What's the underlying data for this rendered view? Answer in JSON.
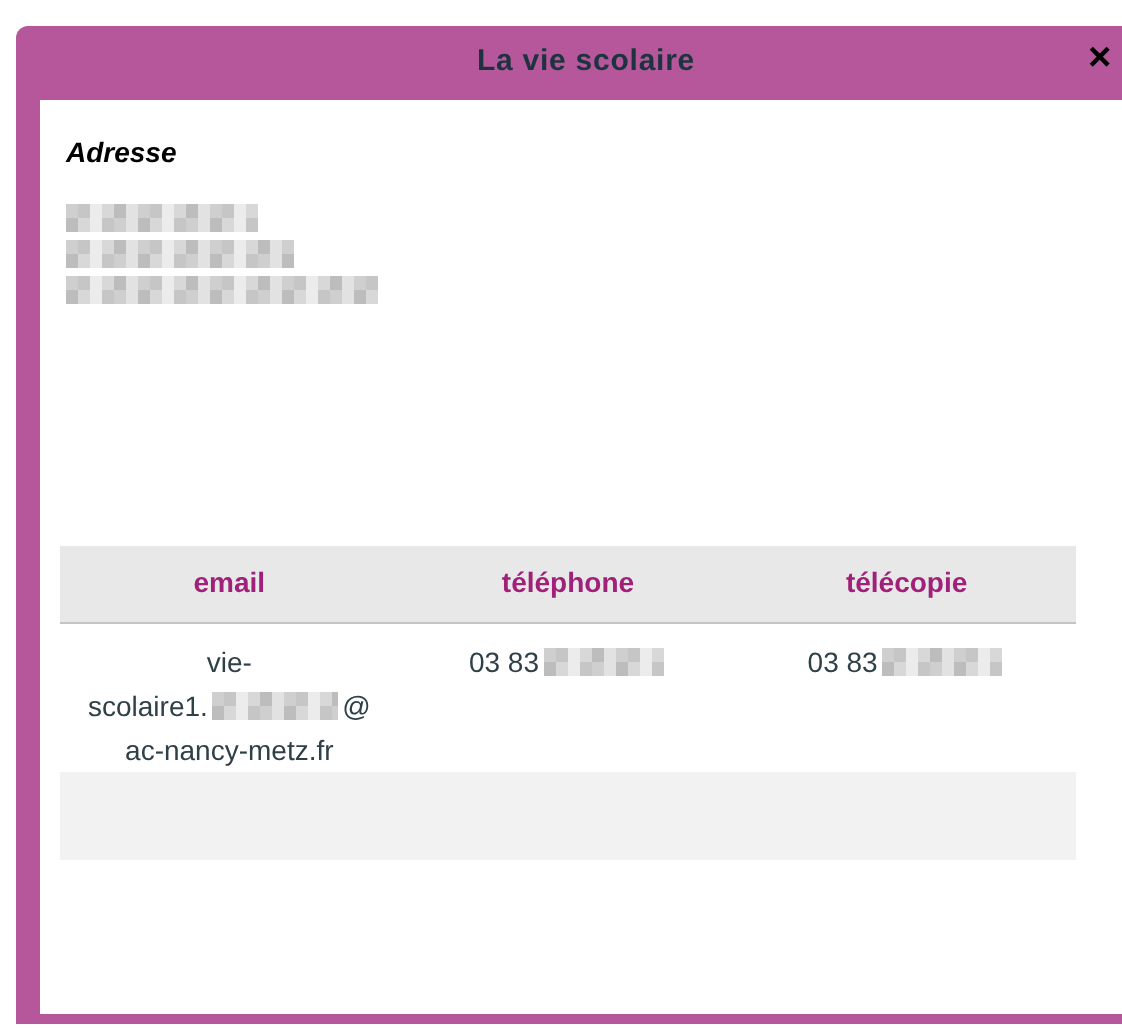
{
  "window": {
    "title": "La vie scolaire",
    "close": "×"
  },
  "address": {
    "label": "Adresse",
    "lines": [
      {
        "kind": "redacted"
      },
      {
        "kind": "redacted"
      },
      {
        "kind": "redacted"
      }
    ]
  },
  "table": {
    "columns": [
      "email",
      "téléphone",
      "télécopie"
    ],
    "rows": [
      [
        {
          "lines": [
            [
              {
                "kind": "text",
                "text": "vie-"
              }
            ],
            [
              {
                "kind": "text",
                "text": "scolaire1."
              },
              {
                "kind": "redacted"
              },
              {
                "kind": "text",
                "text": "@"
              }
            ],
            [
              {
                "kind": "text",
                "text": "ac-nancy-metz.fr"
              }
            ]
          ]
        },
        {
          "lines": [
            [
              {
                "kind": "text",
                "text": "03 83"
              },
              {
                "kind": "redacted"
              }
            ]
          ]
        },
        {
          "lines": [
            [
              {
                "kind": "text",
                "text": "03 83"
              },
              {
                "kind": "redacted"
              }
            ]
          ]
        }
      ]
    ]
  }
}
